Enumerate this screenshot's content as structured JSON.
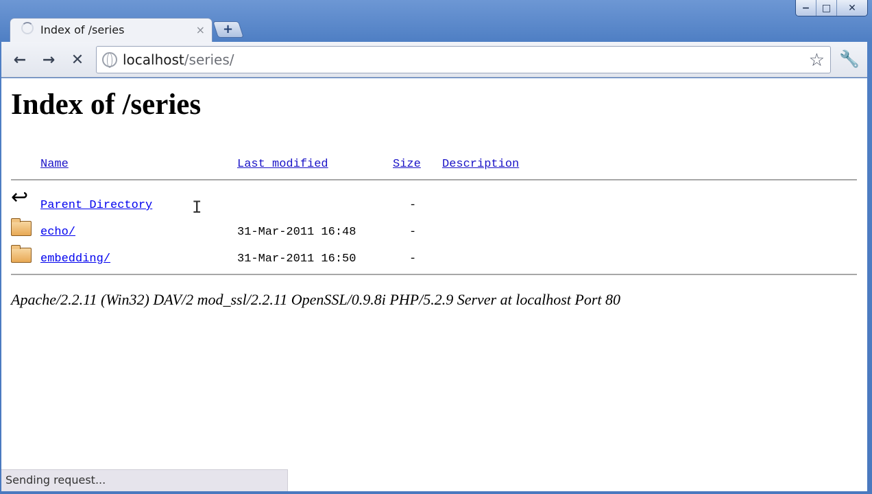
{
  "window": {
    "minimize_glyph": "−",
    "maximize_glyph": "□",
    "close_glyph": "✕"
  },
  "tab": {
    "title": "Index of /series",
    "close_glyph": "×",
    "new_tab_glyph": "+"
  },
  "toolbar": {
    "back_glyph": "←",
    "forward_glyph": "→",
    "stop_glyph": "✕",
    "url_host": "localhost",
    "url_path": "/series/",
    "star_glyph": "☆",
    "wrench_glyph": "🔧"
  },
  "page": {
    "heading": "Index of /series",
    "columns": {
      "name": "Name",
      "last_modified": "Last modified",
      "size": "Size",
      "description": "Description"
    },
    "rows": [
      {
        "name": "Parent Directory",
        "icon": "back-icon",
        "modified": "",
        "size": "-"
      },
      {
        "name": "echo/",
        "icon": "folder-icon",
        "modified": "31-Mar-2011 16:48",
        "size": "-"
      },
      {
        "name": "embedding/",
        "icon": "folder-icon",
        "modified": "31-Mar-2011 16:50",
        "size": "-"
      }
    ],
    "address": "Apache/2.2.11 (Win32) DAV/2 mod_ssl/2.2.11 OpenSSL/0.9.8i PHP/5.2.9 Server at localhost Port 80"
  },
  "status_bar": {
    "text": "Sending request..."
  },
  "colors": {
    "link": "#1a13c7",
    "frame": "#4f7fc4"
  }
}
